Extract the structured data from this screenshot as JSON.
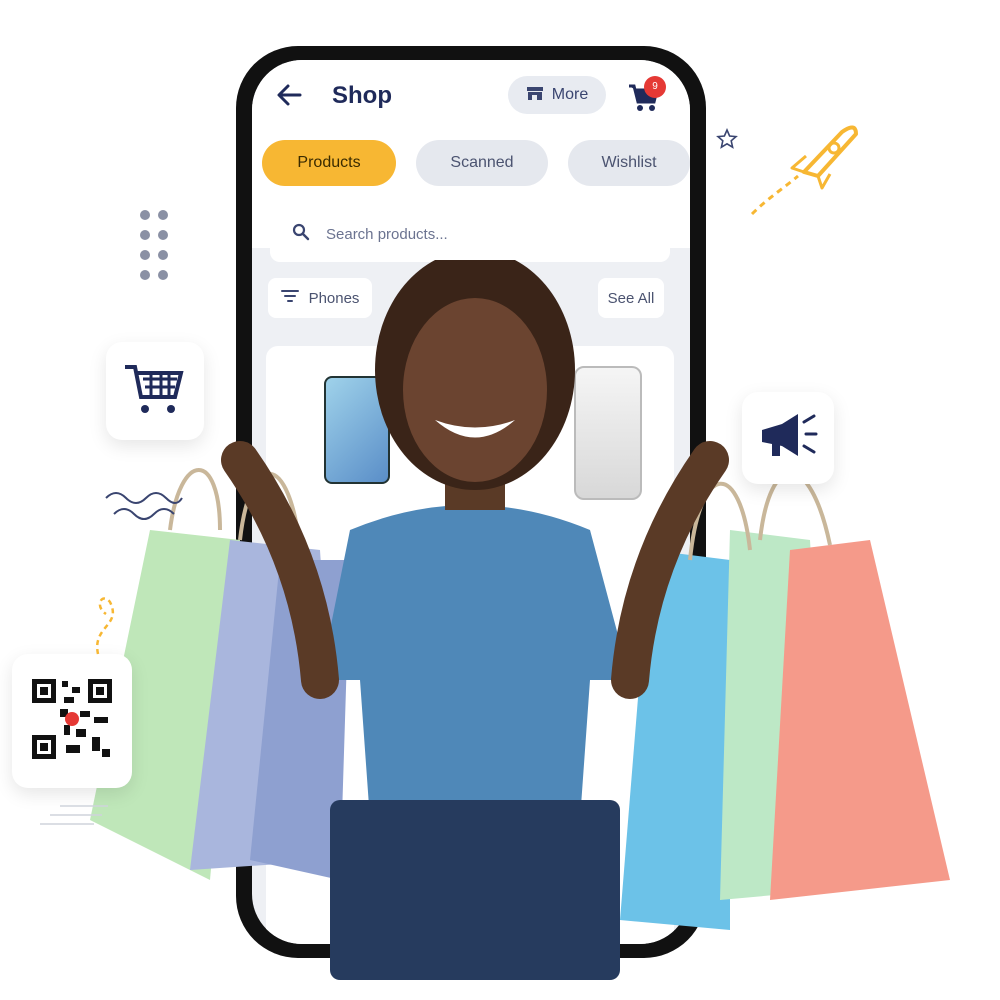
{
  "header": {
    "title": "Shop",
    "more_label": "More",
    "cart_count": "9"
  },
  "tabs": [
    {
      "label": "Products",
      "active": true
    },
    {
      "label": "Scanned",
      "active": false
    },
    {
      "label": "Wishlist",
      "active": false
    }
  ],
  "search": {
    "placeholder": "Search products..."
  },
  "filter": {
    "category_label": "Phones",
    "see_all_label": "See All"
  },
  "colors": {
    "accent": "#f7b733",
    "brand_dark": "#1f2a5a",
    "badge": "#e53935"
  },
  "icons": [
    "back-arrow-icon",
    "store-icon",
    "shopping-cart-icon",
    "search-icon",
    "filter-icon",
    "cart-icon",
    "megaphone-icon",
    "qr-code-icon",
    "rocket-icon",
    "star-icon"
  ]
}
